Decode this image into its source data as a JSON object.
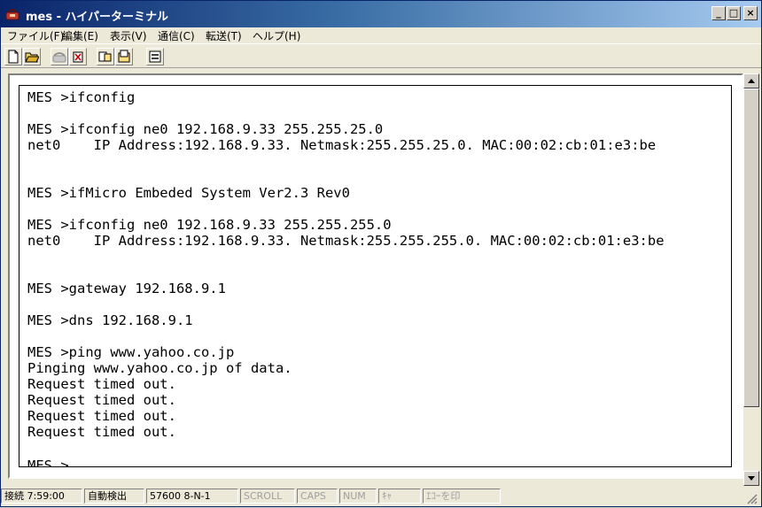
{
  "window": {
    "title": "mes - ハイパーターミナル",
    "minimize_label": "_",
    "maximize_label": "□",
    "close_label": "×"
  },
  "menu": {
    "items": [
      "ファイル(F)",
      "編集(E)",
      "表示(V)",
      "通信(C)",
      "転送(T)",
      "ヘルプ(H)"
    ]
  },
  "toolbar": {
    "icons": [
      "new-document-icon",
      "open-folder-icon",
      "phone-connect-icon",
      "disconnect-icon",
      "send-icon",
      "receive-icon",
      "properties-icon"
    ]
  },
  "terminal": {
    "lines": [
      "MES >ifconfig",
      "",
      "MES >ifconfig ne0 192.168.9.33 255.255.25.0",
      "net0    IP Address:192.168.9.33. Netmask:255.255.25.0. MAC:00:02:cb:01:e3:be",
      "",
      "",
      "MES >ifMicro Embeded System Ver2.3 Rev0",
      "",
      "MES >ifconfig ne0 192.168.9.33 255.255.255.0",
      "net0    IP Address:192.168.9.33. Netmask:255.255.255.0. MAC:00:02:cb:01:e3:be",
      "",
      "",
      "MES >gateway 192.168.9.1",
      "",
      "MES >dns 192.168.9.1",
      "",
      "MES >ping www.yahoo.co.jp",
      "Pinging www.yahoo.co.jp of data.",
      "Request timed out.",
      "Request timed out.",
      "Request timed out.",
      "Request timed out.",
      "",
      "MES >"
    ]
  },
  "status": {
    "connection": "接続 7:59:00",
    "detect": "自動検出",
    "port_settings": "57600 8-N-1",
    "scroll": "SCROLL",
    "caps": "CAPS",
    "num": "NUM",
    "capture": "ｷｬ",
    "echo": "ｴｺｰを印"
  },
  "colors": {
    "title_gradient_start": "#0a246a",
    "title_gradient_end": "#a6caf0",
    "chrome": "#ece9d8",
    "terminal_bg": "#ffffff",
    "terminal_fg": "#000000"
  }
}
